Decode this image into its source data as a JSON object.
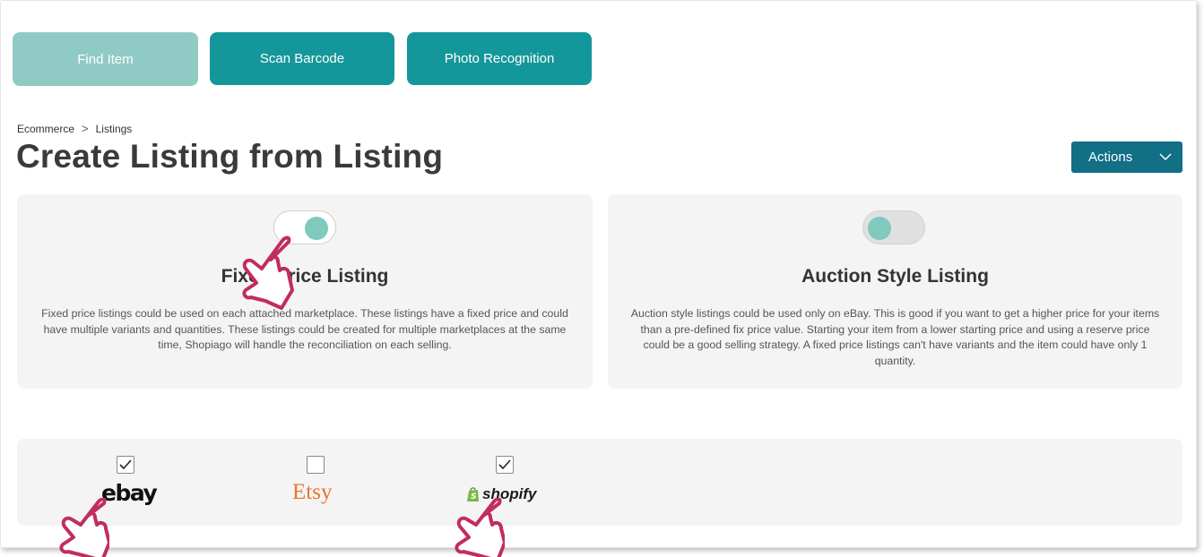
{
  "toolbar": {
    "find_label": "Find Item",
    "scan_label": "Scan Barcode",
    "photo_label": "Photo Recognition",
    "find_color": "#8fcbc4",
    "action_color": "#14979a"
  },
  "breadcrumb": {
    "items": [
      "Ecommerce",
      "Listings"
    ],
    "separator": ">"
  },
  "page": {
    "title": "Create Listing from Listing",
    "actions_label": "Actions",
    "actions_color": "#116f86"
  },
  "listing_types": [
    {
      "title": "Fixed Price Listing",
      "enabled": true,
      "description": "Fixed price listings could be used on each attached marketplace. These listings have a fixed price and could have multiple variants and quantities. These listings could be created for multiple marketplaces at the same time, Shopiago will handle the reconciliation on each selling."
    },
    {
      "title": "Auction Style Listing",
      "enabled": false,
      "description": "Auction style listings could be used only on eBay. This is good if you want to get a higher price for your items than a pre-defined fix price value. Starting your item from a lower starting price and using a reserve price could be a good selling strategy. A fixed price listings can't have variants and the item could have only 1 quantity."
    }
  ],
  "marketplaces": [
    {
      "name": "ebay",
      "checked": true
    },
    {
      "name": "Etsy",
      "checked": false
    },
    {
      "name": "shopify",
      "checked": true
    }
  ],
  "icons": {
    "cursor": "hand-pointer-icon",
    "chevron": "chevron-down-icon",
    "check": "checkmark-icon"
  }
}
